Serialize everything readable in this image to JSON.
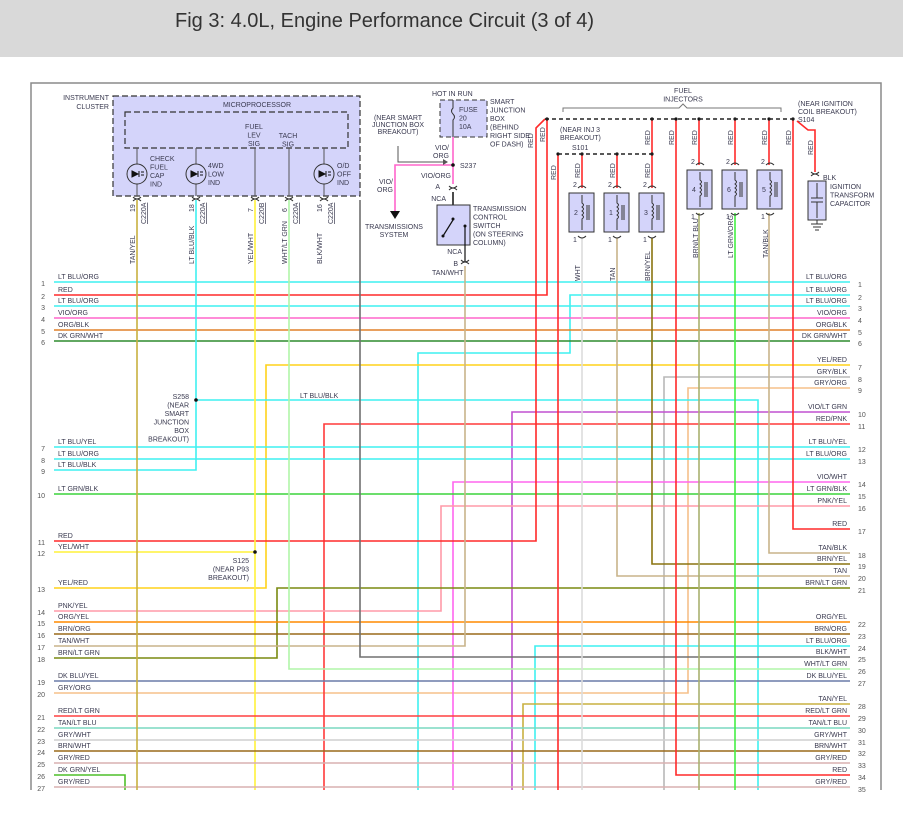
{
  "header": {
    "title": "Fig 3: 4.0L, Engine Performance Circuit (3 of 4)"
  },
  "instrument_cluster": {
    "label": [
      "INSTRUMENT",
      "CLUSTER"
    ],
    "microprocessor": "MICROPROCESSOR",
    "fuel_lev_sig": [
      "FUEL",
      "LEV",
      "SIG"
    ],
    "tach_sig": [
      "TACH",
      "SIG"
    ],
    "indicators": [
      {
        "label": [
          "CHECK",
          "FUEL",
          "CAP",
          "IND"
        ]
      },
      {
        "label": [
          "4WD",
          "LOW",
          "IND"
        ]
      },
      {
        "label": [
          "O/D",
          "OFF",
          "IND"
        ]
      }
    ],
    "pins": [
      {
        "wire": "TAN/YEL",
        "pin": "19",
        "connector": "C220A"
      },
      {
        "wire": "LT BLU/BLK",
        "pin": "18",
        "connector": "C220A"
      },
      {
        "wire": "YEL/WHT",
        "pin": "7",
        "connector": "C220B"
      },
      {
        "wire": "WHT/LT GRN",
        "pin": "6",
        "connector": "C220A"
      },
      {
        "wire": "BLK/WHT",
        "pin": "16",
        "connector": "C220A"
      }
    ]
  },
  "smart_junction": {
    "hot_in_run": "HOT IN RUN",
    "fuse": [
      "FUSE",
      "20",
      "10A"
    ],
    "label": [
      "SMART",
      "JUNCTION",
      "BOX",
      "(BEHIND",
      "RIGHT SIDE",
      "OF DASH)"
    ],
    "breakout_note": [
      "(NEAR SMART",
      "JUNCTION BOX",
      "BREAKOUT)"
    ],
    "wire_top": [
      "VIO/",
      "ORG"
    ],
    "splice": "S237",
    "branch_wire": [
      "VIO/",
      "ORG"
    ],
    "branch_dest": [
      "TRANSMISSIONS",
      "SYSTEM"
    ],
    "wire_below": "VIO/ORG"
  },
  "trans_switch": {
    "pin_a": "A",
    "nca_top": "NCA",
    "label": [
      "TRANSMISSION",
      "CONTROL",
      "SWITCH",
      "(ON STEERING",
      "COLUMN)"
    ],
    "nca_bottom": "NCA",
    "pin_b": "B",
    "wire": "TAN/WHT"
  },
  "injectors": {
    "title": [
      "FUEL",
      "INJECTORS"
    ],
    "s101_note": [
      "(NEAR INJ 3",
      "BREAKOUT)"
    ],
    "s101": "S101",
    "s104_note": [
      "(NEAR IGNITION",
      "COIL BREAKOUT)"
    ],
    "s104": "S104",
    "feed_wire": "RED",
    "pin_in": "2",
    "pin_out": "1",
    "units": [
      {
        "num": "2",
        "wire": "WHT"
      },
      {
        "num": "1",
        "wire": "TAN"
      },
      {
        "num": "3",
        "wire": "BRN/YEL"
      },
      {
        "num": "4",
        "wire": "BRN/LT BLU"
      },
      {
        "num": "6",
        "wire": "LT GRN/ORG"
      },
      {
        "num": "5",
        "wire": "TAN/BLK"
      }
    ]
  },
  "capacitor": {
    "wire_in": "RED",
    "wire_out": "BLK",
    "label": [
      "IGNITION",
      "TRANSFORM",
      "CAPACITOR"
    ]
  },
  "splices": {
    "s258": [
      "S258",
      "(NEAR",
      "SMART",
      "JUNCTION",
      "BOX",
      "BREAKOUT)"
    ],
    "s258_wire": "LT BLU/BLK",
    "s125": [
      "S125",
      "(NEAR P93",
      "BREAKOUT)"
    ]
  },
  "left_rows": [
    {
      "pin": "1",
      "label": "LT BLU/ORG"
    },
    {
      "pin": "2",
      "label": "RED"
    },
    {
      "pin": "3",
      "label": "LT BLU/ORG"
    },
    {
      "pin": "4",
      "label": "VIO/ORG"
    },
    {
      "pin": "5",
      "label": "ORG/BLK"
    },
    {
      "pin": "6",
      "label": "DK GRN/WHT"
    },
    {
      "pin": "7",
      "label": "LT BLU/YEL"
    },
    {
      "pin": "8",
      "label": "LT BLU/ORG"
    },
    {
      "pin": "9",
      "label": "LT BLU/BLK"
    },
    {
      "pin": "10",
      "label": "LT GRN/BLK"
    },
    {
      "pin": "11",
      "label": "RED"
    },
    {
      "pin": "12",
      "label": "YEL/WHT"
    },
    {
      "pin": "13",
      "label": "YEL/RED"
    },
    {
      "pin": "14",
      "label": "PNK/YEL"
    },
    {
      "pin": "15",
      "label": "ORG/YEL"
    },
    {
      "pin": "16",
      "label": "BRN/ORG"
    },
    {
      "pin": "17",
      "label": "TAN/WHT"
    },
    {
      "pin": "18",
      "label": "BRN/LT GRN"
    },
    {
      "pin": "19",
      "label": "DK BLU/YEL"
    },
    {
      "pin": "20",
      "label": "GRY/ORG"
    },
    {
      "pin": "21",
      "label": "RED/LT GRN"
    },
    {
      "pin": "22",
      "label": "TAN/LT BLU"
    },
    {
      "pin": "23",
      "label": "GRY/WHT"
    },
    {
      "pin": "24",
      "label": "BRN/WHT"
    },
    {
      "pin": "25",
      "label": "GRY/RED"
    },
    {
      "pin": "26",
      "label": "DK GRN/YEL"
    },
    {
      "pin": "27",
      "label": "GRY/RED"
    }
  ],
  "right_rows": [
    {
      "pin": "1",
      "label": "LT BLU/ORG"
    },
    {
      "pin": "2",
      "label": "LT BLU/ORG"
    },
    {
      "pin": "3",
      "label": "LT BLU/ORG"
    },
    {
      "pin": "4",
      "label": "VIO/ORG"
    },
    {
      "pin": "5",
      "label": "ORG/BLK"
    },
    {
      "pin": "6",
      "label": "DK GRN/WHT"
    },
    {
      "pin": "7",
      "label": "YEL/RED"
    },
    {
      "pin": "8",
      "label": "GRY/BLK"
    },
    {
      "pin": "9",
      "label": "GRY/ORG"
    },
    {
      "pin": "10",
      "label": "VIO/LT GRN"
    },
    {
      "pin": "11",
      "label": "RED/PNK"
    },
    {
      "pin": "12",
      "label": "LT BLU/YEL"
    },
    {
      "pin": "13",
      "label": "LT BLU/ORG"
    },
    {
      "pin": "14",
      "label": "VIO/WHT"
    },
    {
      "pin": "15",
      "label": "LT GRN/BLK"
    },
    {
      "pin": "16",
      "label": "PNK/YEL"
    },
    {
      "pin": "17",
      "label": "RED"
    },
    {
      "pin": "18",
      "label": "TAN/BLK"
    },
    {
      "pin": "19",
      "label": "BRN/YEL"
    },
    {
      "pin": "20",
      "label": "TAN"
    },
    {
      "pin": "21",
      "label": "BRN/LT GRN"
    },
    {
      "pin": "22",
      "label": "ORG/YEL"
    },
    {
      "pin": "23",
      "label": "BRN/ORG"
    },
    {
      "pin": "24",
      "label": "LT BLU/ORG"
    },
    {
      "pin": "25",
      "label": "BLK/WHT"
    },
    {
      "pin": "26",
      "label": "WHT/LT GRN"
    },
    {
      "pin": "27",
      "label": "DK BLU/YEL"
    },
    {
      "pin": "28",
      "label": "TAN/YEL"
    },
    {
      "pin": "29",
      "label": "RED/LT GRN"
    },
    {
      "pin": "30",
      "label": "TAN/LT BLU"
    },
    {
      "pin": "31",
      "label": "GRY/WHT"
    },
    {
      "pin": "32",
      "label": "BRN/WHT"
    },
    {
      "pin": "33",
      "label": "GRY/RED"
    },
    {
      "pin": "34",
      "label": "RED"
    },
    {
      "pin": "35",
      "label": "GRY/RED"
    }
  ],
  "wire_colors": {
    "LT BLU/ORG": "#3ff0f0",
    "RED": "#ff2a2a",
    "VIO/ORG": "#ff66cc",
    "ORG/BLK": "#e0802a",
    "DK GRN/WHT": "#2e8b2e",
    "YEL/RED": "#ffd21a",
    "GRY/BLK": "#b8b8b8",
    "GRY/ORG": "#f5c08a",
    "LT BLU/BLK": "#3ff0f0",
    "VIO/LT GRN": "#c050d0",
    "RED/PNK": "#ff3a3a",
    "LT BLU/YEL": "#3ff0f0",
    "VIO/WHT": "#ff66ee",
    "LT GRN/BLK": "#3bd43b",
    "PNK/YEL": "#ff9aa8",
    "YEL/WHT": "#fff23a",
    "TAN/BLK": "#c8b48a",
    "BRN/YEL": "#8a7410",
    "TAN": "#c8b48a",
    "BRN/LT GRN": "#7a8a10",
    "ORG/YEL": "#ff8a00",
    "BRN/ORG": "#9a6a1a",
    "TAN/WHT": "#c8b48a",
    "BLK/WHT": "#707070",
    "WHT/LT GRN": "#b0f5a8",
    "DK BLU/YEL": "#6a7ca8",
    "TAN/YEL": "#c8b040",
    "RED/LT GRN": "#ff4040",
    "TAN/LT BLU": "#7ad8c0",
    "GRY/WHT": "#cfcfcf",
    "BRN/WHT": "#9a6a1a",
    "GRY/RED": "#d8b0b0",
    "DK GRN/YEL": "#4fbf2a",
    "WHT": "#dcdcdc",
    "BRN/LT BLU": "#a8b070",
    "LT GRN/ORG": "#44ee44"
  }
}
